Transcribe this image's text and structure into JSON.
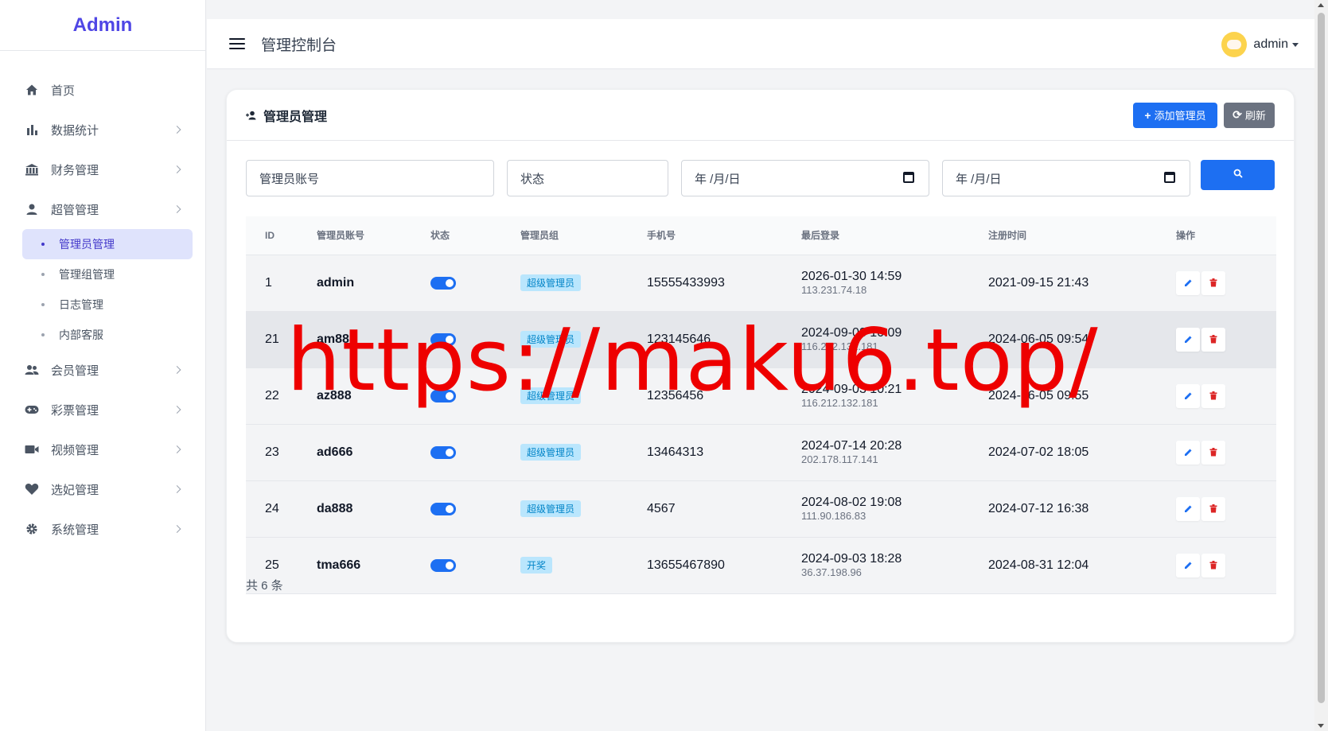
{
  "brand": "Admin",
  "header": {
    "title": "管理控制台",
    "username": "admin"
  },
  "sidebar": {
    "items": [
      {
        "label": "首页",
        "icon": "home-icon"
      },
      {
        "label": "数据统计",
        "icon": "bar-chart-icon"
      },
      {
        "label": "财务管理",
        "icon": "bank-icon"
      },
      {
        "label": "超管管理",
        "icon": "user-icon"
      },
      {
        "label": "会员管理",
        "icon": "users-icon"
      },
      {
        "label": "彩票管理",
        "icon": "gamepad-icon"
      },
      {
        "label": "视频管理",
        "icon": "video-icon"
      },
      {
        "label": "选妃管理",
        "icon": "heart-icon"
      },
      {
        "label": "系统管理",
        "icon": "gear-icon"
      }
    ],
    "sub_items": [
      "管理员管理",
      "管理组管理",
      "日志管理",
      "内部客服"
    ]
  },
  "card": {
    "title": "管理员管理",
    "add_button": "添加管理员",
    "refresh_button": "刷新"
  },
  "filters": {
    "account_placeholder": "管理员账号",
    "status_placeholder": "状态",
    "date_start": "年 /月/日",
    "date_end": "年 /月/日"
  },
  "table": {
    "headers": [
      "ID",
      "管理员账号",
      "状态",
      "管理员组",
      "手机号",
      "最后登录",
      "注册时间",
      "操作"
    ],
    "rows": [
      {
        "id": "1",
        "account": "admin",
        "group": "超级管理员",
        "phone": "15555433993",
        "login_time": "2026-01-30 14:59",
        "login_ip": "113.231.74.18",
        "registered": "2021-09-15 21:43",
        "enabled": true
      },
      {
        "id": "21",
        "account": "am888",
        "group": "超级管理员",
        "phone": "123145646",
        "login_time": "2024-09-03 10:09",
        "login_ip": "116.212.132.181",
        "registered": "2024-06-05 09:54",
        "enabled": true
      },
      {
        "id": "22",
        "account": "az888",
        "group": "超级管理员",
        "phone": "12356456",
        "login_time": "2024-09-03 10:21",
        "login_ip": "116.212.132.181",
        "registered": "2024-06-05 09:55",
        "enabled": true
      },
      {
        "id": "23",
        "account": "ad666",
        "group": "超级管理员",
        "phone": "13464313",
        "login_time": "2024-07-14 20:28",
        "login_ip": "202.178.117.141",
        "registered": "2024-07-02 18:05",
        "enabled": true
      },
      {
        "id": "24",
        "account": "da888",
        "group": "超级管理员",
        "phone": "4567",
        "login_time": "2024-08-02 19:08",
        "login_ip": "111.90.186.83",
        "registered": "2024-07-12 16:38",
        "enabled": true
      },
      {
        "id": "25",
        "account": "tma666",
        "group": "开奖",
        "phone": "13655467890",
        "login_time": "2024-09-03 18:28",
        "login_ip": "36.37.198.96",
        "registered": "2024-08-31 12:04",
        "enabled": true
      }
    ]
  },
  "total_text": "共 6 条",
  "watermark": "https://maku6.top/",
  "colors": {
    "accent": "#1d6ff2",
    "brand": "#4f46e5",
    "badge_bg": "#bae6fd",
    "danger": "#dc2626",
    "watermark": "#ee0000"
  }
}
